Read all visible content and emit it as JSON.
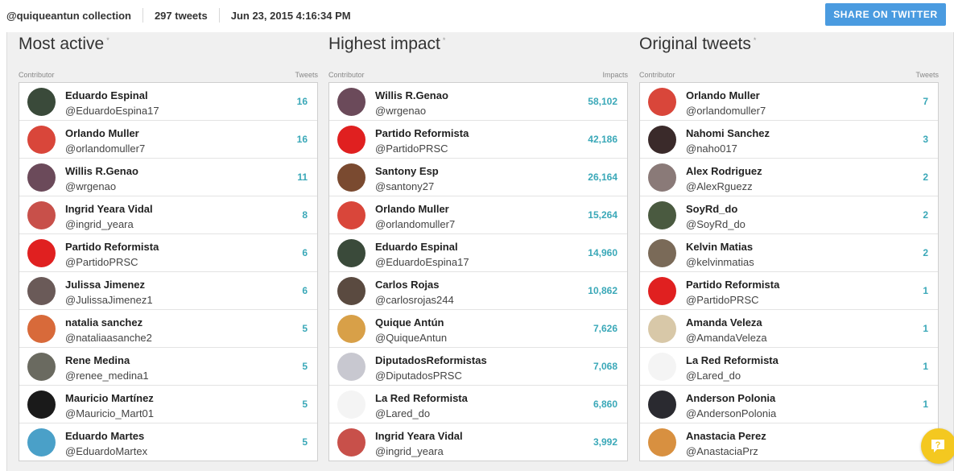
{
  "header": {
    "collection": "@quiqueantun collection",
    "tweets": "297 tweets",
    "timestamp": "Jun 23, 2015 4:16:34 PM",
    "share_label": "SHARE ON TWITTER"
  },
  "columns": [
    {
      "title": "Most active",
      "marker": "*",
      "head_left": "Contributor",
      "head_right": "Tweets",
      "rows": [
        {
          "name": "Eduardo Espinal",
          "handle": "@EduardoEspina17",
          "count": "16",
          "avatar": "#3a4a3a"
        },
        {
          "name": "Orlando Muller",
          "handle": "@orlandomuller7",
          "count": "16",
          "avatar": "#d9463a"
        },
        {
          "name": "Willis R.Genao",
          "handle": "@wrgenao",
          "count": "11",
          "avatar": "#6b4a5a"
        },
        {
          "name": "Ingrid Yeara Vidal",
          "handle": "@ingrid_yeara",
          "count": "8",
          "avatar": "#c8504a"
        },
        {
          "name": "Partido Reformista",
          "handle": "@PartidoPRSC",
          "count": "6",
          "avatar": "#e02020"
        },
        {
          "name": "Julissa Jimenez",
          "handle": "@JulissaJimenez1",
          "count": "6",
          "avatar": "#6a5a58"
        },
        {
          "name": "natalia sanchez",
          "handle": "@nataliaasanche2",
          "count": "5",
          "avatar": "#d86a3a"
        },
        {
          "name": "Rene Medina",
          "handle": "@renee_medina1",
          "count": "5",
          "avatar": "#6a6a60"
        },
        {
          "name": "Mauricio Martínez",
          "handle": "@Mauricio_Mart01",
          "count": "5",
          "avatar": "#1a1a1a"
        },
        {
          "name": "Eduardo Martes",
          "handle": "@EduardoMartex",
          "count": "5",
          "avatar": "#4aa0c8"
        }
      ]
    },
    {
      "title": "Highest impact",
      "marker": "*",
      "head_left": "Contributor",
      "head_right": "Impacts",
      "rows": [
        {
          "name": "Willis R.Genao",
          "handle": "@wrgenao",
          "count": "58,102",
          "avatar": "#6b4a5a"
        },
        {
          "name": "Partido Reformista",
          "handle": "@PartidoPRSC",
          "count": "42,186",
          "avatar": "#e02020"
        },
        {
          "name": "Santony Esp",
          "handle": "@santony27",
          "count": "26,164",
          "avatar": "#7a4a30"
        },
        {
          "name": "Orlando Muller",
          "handle": "@orlandomuller7",
          "count": "15,264",
          "avatar": "#d9463a"
        },
        {
          "name": "Eduardo Espinal",
          "handle": "@EduardoEspina17",
          "count": "14,960",
          "avatar": "#3a4a3a"
        },
        {
          "name": "Carlos Rojas",
          "handle": "@carlosrojas244",
          "count": "10,862",
          "avatar": "#5a4a40"
        },
        {
          "name": "Quique Antún",
          "handle": "@QuiqueAntun",
          "count": "7,626",
          "avatar": "#d8a048"
        },
        {
          "name": "DiputadosReformistas",
          "handle": "@DiputadosPRSC",
          "count": "7,068",
          "avatar": "#c8c8d0"
        },
        {
          "name": "La Red Reformista",
          "handle": "@Lared_do",
          "count": "6,860",
          "avatar": "#f4f4f4"
        },
        {
          "name": "Ingrid Yeara Vidal",
          "handle": "@ingrid_yeara",
          "count": "3,992",
          "avatar": "#c8504a"
        }
      ]
    },
    {
      "title": "Original tweets",
      "marker": "*",
      "head_left": "Contributor",
      "head_right": "Tweets",
      "rows": [
        {
          "name": "Orlando Muller",
          "handle": "@orlandomuller7",
          "count": "7",
          "avatar": "#d9463a"
        },
        {
          "name": "Nahomi Sanchez",
          "handle": "@naho017",
          "count": "3",
          "avatar": "#3a2a2a"
        },
        {
          "name": "Alex Rodriguez",
          "handle": "@AlexRguezz",
          "count": "2",
          "avatar": "#8a7a78"
        },
        {
          "name": "SoyRd_do",
          "handle": "@SoyRd_do",
          "count": "2",
          "avatar": "#4a5a40"
        },
        {
          "name": "Kelvin Matias",
          "handle": "@kelvinmatias",
          "count": "2",
          "avatar": "#7a6a58"
        },
        {
          "name": "Partido Reformista",
          "handle": "@PartidoPRSC",
          "count": "1",
          "avatar": "#e02020"
        },
        {
          "name": "Amanda Veleza",
          "handle": "@AmandaVeleza",
          "count": "1",
          "avatar": "#d8c8a8"
        },
        {
          "name": "La Red Reformista",
          "handle": "@Lared_do",
          "count": "1",
          "avatar": "#f4f4f4"
        },
        {
          "name": "Anderson Polonia",
          "handle": "@AndersonPolonia",
          "count": "1",
          "avatar": "#2a2a30"
        },
        {
          "name": "Anastacia Perez",
          "handle": "@AnastaciaPrz",
          "count": "",
          "avatar": "#d89040"
        }
      ]
    }
  ],
  "colors": {
    "accent": "#4a9be0",
    "count": "#3aa8b8",
    "help": "#f4c820"
  },
  "icons": {
    "help": "chat-help-icon"
  }
}
